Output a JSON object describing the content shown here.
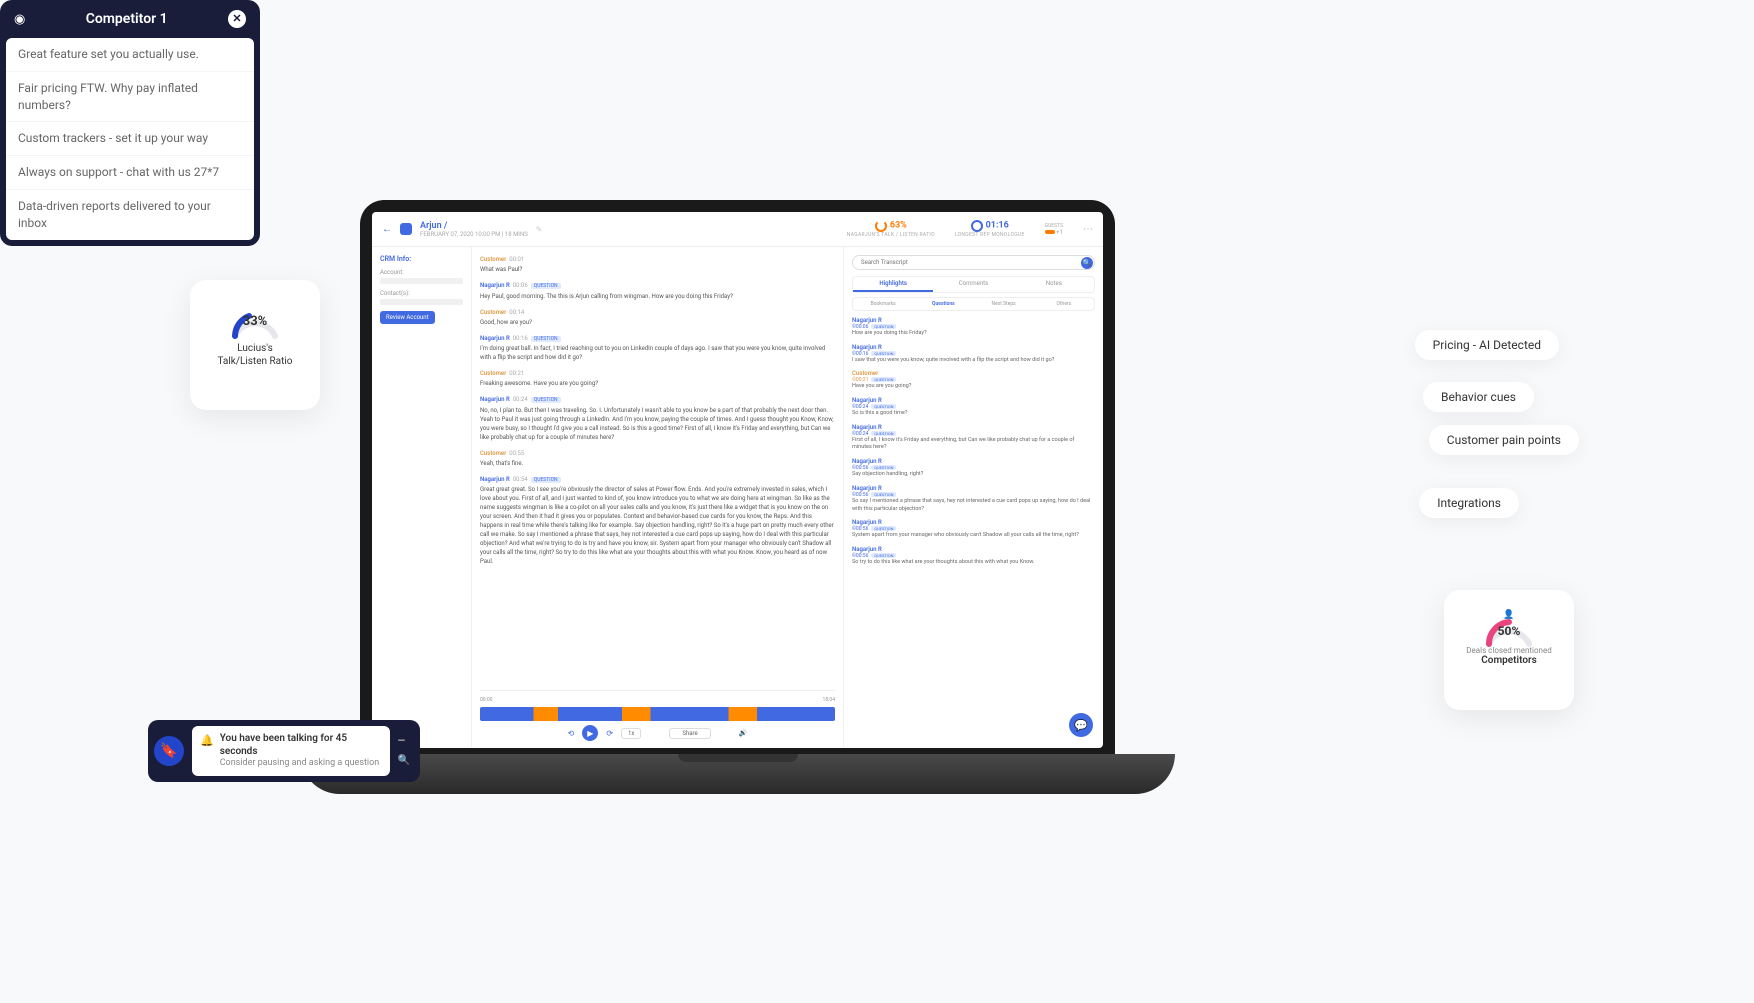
{
  "app": {
    "header": {
      "name": "Arjun /",
      "meta": "FEBRUARY 07, 2020 10:00 PM | 18 MINS",
      "talk_ratio": "63%",
      "talk_ratio_label": "NAGARJUN'S TALK / LISTEN RATIO",
      "monologue": "01:16",
      "monologue_label": "LONGEST REP MONOLOGUE",
      "guests_label": "GUESTS",
      "guests_extra": "+1"
    },
    "crm": {
      "title": "CRM Info:",
      "account": "Account:",
      "contacts": "Contact(s):",
      "review": "Review Account"
    },
    "transcript": [
      {
        "who": "c",
        "name": "Customer",
        "ts": "00:01",
        "text": "What was Paul?"
      },
      {
        "who": "r",
        "name": "Nagarjun R",
        "ts": "00:06",
        "q": true,
        "text": "Hey Paul, good morning. The this is Arjun calling from wingman. How are you doing this Friday?"
      },
      {
        "who": "c",
        "name": "Customer",
        "ts": "00:14",
        "text": "Good, how are you?"
      },
      {
        "who": "r",
        "name": "Nagarjun R",
        "ts": "00:16",
        "q": true,
        "text": "I'm doing great ball. In fact, I tried reaching out to you on LinkedIn couple of days ago. I saw that you were you know, quite involved with a flip the script and how did it go?"
      },
      {
        "who": "c",
        "name": "Customer",
        "ts": "00:21",
        "text": "Freaking awesome. Have you are you going?"
      },
      {
        "who": "r",
        "name": "Nagarjun R",
        "ts": "00:24",
        "q": true,
        "text": "No, no, I plan to. But then I was traveling. So. I. Unfortunately I wasn't able to you know be a part of that probably the next door then. Yeah to Paul it was just going through a LinkedIn. And I'm you know, paying the couple of times. And I guess thought you Know, Know, you were busy, so I thought I'd give you a call instead. So is this a good time? First of all, I know it's Friday and everything, but Can we like probably chat up for a couple of minutes here?"
      },
      {
        "who": "c",
        "name": "Customer",
        "ts": "00:55",
        "text": "Yeah, that's fine."
      },
      {
        "who": "r",
        "name": "Nagarjun R",
        "ts": "00:54",
        "q": true,
        "text": "Great great great. So I see you're obviously the director of sales at Power flow. Ends. And you're extremely invested in sales, which I love about you. First of all, and I just wanted to kind of, you know introduce you to what we are doing here at wingman. So like as the name suggests wingman is like a co-pilot on all your sales calls and you know, it's just there like a widget that is you know on the on your screen. And then it had it gives you or populates. Context and behavior-based cue cards for you know, the Reps. And this happens in real time while there's talking like for example. Say objection handling, right? So it's a huge part on pretty much every other call we make. So say I mentioned a phrase that says, hey not interested a cue card pops up saying, how do I deal with this particular objection? And what we're trying to do is try and have you know, sir. System apart from your manager who obviously can't Shadow all your calls all the time, right? So try to do this like what are your thoughts about this with what you Know. Know, you heard as of now Paul."
      }
    ],
    "player": {
      "start": "00:00",
      "end": "18:04",
      "speed": "1x",
      "share": "Share"
    },
    "right": {
      "search_placeholder": "Search Transcript",
      "tabs1": [
        "Highlights",
        "Comments",
        "Notes"
      ],
      "tabs2": [
        "Bookmarks",
        "Questions",
        "Next Steps",
        "Others"
      ],
      "questions": [
        {
          "name": "Nagarjun R",
          "ts": "©00:06",
          "text": "How are you doing this Friday?"
        },
        {
          "name": "Nagarjun R",
          "ts": "©00:16",
          "text": "I saw that you were you know, quite involved with a flip the script and how did it go?"
        },
        {
          "name": "Customer",
          "ts": "©00:21",
          "c": true,
          "text": "Have you are you going?"
        },
        {
          "name": "Nagarjun R",
          "ts": "©00:24",
          "text": "So is this a good time?"
        },
        {
          "name": "Nagarjun R",
          "ts": "©00:24",
          "text": "First of all, I know it's Friday and everything, but Can we like probably chat up for a couple of minutes here?"
        },
        {
          "name": "Nagarjun R",
          "ts": "©00:56",
          "text": "Say objection handling, right?"
        },
        {
          "name": "Nagarjun R",
          "ts": "©00:56",
          "text": "So say I mentioned a phrase that says, hey not interested a cue card pops up saying, how do I deal with this particular objection?"
        },
        {
          "name": "Nagarjun R",
          "ts": "©00:56",
          "text": "System apart from your manager who obviously can't Shadow all your calls all the time, right?"
        },
        {
          "name": "Nagarjun R",
          "ts": "©00:56",
          "text": "So try to do this like what are your thoughts about this with what you Know."
        }
      ]
    }
  },
  "ratio": {
    "pct": "33%",
    "label": "Lucius's\nTalk/Listen Ratio"
  },
  "competitor": {
    "title": "Competitor 1",
    "items": [
      "Great feature set you actually use.",
      "Fair pricing FTW. Why pay inflated numbers?",
      "Custom trackers - set it up your way",
      "Always on support - chat with us 27*7",
      "Data-driven reports delivered to your inbox"
    ]
  },
  "notif": {
    "title": "You have been talking for 45 seconds",
    "sub": "Consider pausing and asking a question"
  },
  "tags": [
    "Pricing - AI Detected",
    "Behavior cues",
    "Customer pain points",
    "Integrations"
  ],
  "deals": {
    "pct": "50%",
    "sub": "Deals closed mentioned",
    "main": "Competitors"
  },
  "chart_data": [
    {
      "type": "gauge",
      "title": "Lucius's Talk/Listen Ratio",
      "value": 33,
      "range": [
        0,
        100
      ],
      "color": "#2345c9"
    },
    {
      "type": "gauge",
      "title": "Deals closed mentioned Competitors",
      "value": 50,
      "range": [
        0,
        100
      ],
      "color": "#e8447f"
    }
  ]
}
